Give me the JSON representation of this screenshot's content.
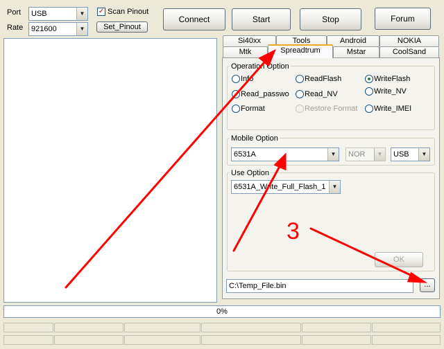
{
  "connection": {
    "port_label": "Port",
    "port_value": "USB",
    "rate_label": "Rate",
    "rate_value": "921600",
    "scan_pinout_label": "Scan Pinout",
    "scan_pinout_checked": true,
    "set_pinout_label": "Set_Pinout"
  },
  "toolbar": {
    "connect_label": "Connect",
    "start_label": "Start",
    "stop_label": "Stop",
    "forum_label": "Forum"
  },
  "tabs": {
    "row1": [
      "Si40xx",
      "Tools",
      "Android",
      "NOKIA"
    ],
    "row2": [
      "Mtk",
      "Spreadtrum",
      "Mstar",
      "CoolSand"
    ],
    "active": "Spreadtrum"
  },
  "operation_option": {
    "title": "Operation Option",
    "options": [
      {
        "label": "Info",
        "selected": false,
        "enabled": true
      },
      {
        "label": "ReadFlash",
        "selected": false,
        "enabled": true
      },
      {
        "label": "WriteFlash",
        "selected": true,
        "enabled": true
      },
      {
        "label": "Read_passwo",
        "selected": false,
        "enabled": true
      },
      {
        "label": "Read_NV",
        "selected": false,
        "enabled": true
      },
      {
        "label": "Write_NV",
        "selected": false,
        "enabled": true
      },
      {
        "label": "Format",
        "selected": false,
        "enabled": true
      },
      {
        "label": "Restore Format",
        "selected": false,
        "enabled": false
      },
      {
        "label": "Write_IMEI",
        "selected": false,
        "enabled": true
      }
    ]
  },
  "mobile_option": {
    "title": "Mobile Option",
    "model_value": "6531A",
    "flash_value": "NOR",
    "interface_value": "USB"
  },
  "use_option": {
    "title": "Use Option",
    "mode_value": "6531A_Write_Full_Flash_1",
    "ok_label": "OK"
  },
  "file": {
    "path_value": "C:\\Temp_File.bin",
    "browse_label": "..."
  },
  "progress": {
    "label": "0%",
    "value": 0
  },
  "annotation": {
    "step_number": "3",
    "color": "#ff0000"
  },
  "colors": {
    "window_bg": "#ece9d8",
    "tab_accent": "#f5a623",
    "panel_bg": "#f4f3ee"
  }
}
